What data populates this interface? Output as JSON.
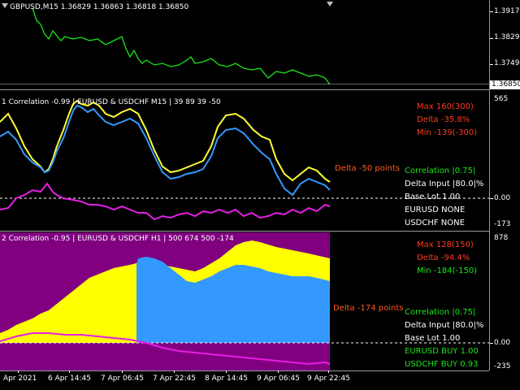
{
  "main": {
    "symbol_header": "GBPUSD,M15  1.36829 1.36863 1.36818 1.36850",
    "price_label": "1.36850",
    "scale": [
      "1.39170",
      "1.38290",
      "1.37490"
    ],
    "series_color": "#19e619",
    "price_path": [
      [
        40,
        10
      ],
      [
        45,
        25
      ],
      [
        50,
        30
      ],
      [
        55,
        42
      ],
      [
        60,
        48
      ],
      [
        65,
        38
      ],
      [
        70,
        44
      ],
      [
        75,
        50
      ],
      [
        80,
        45
      ],
      [
        90,
        48
      ],
      [
        100,
        46
      ],
      [
        110,
        50
      ],
      [
        120,
        48
      ],
      [
        130,
        55
      ],
      [
        140,
        50
      ],
      [
        150,
        45
      ],
      [
        155,
        60
      ],
      [
        160,
        70
      ],
      [
        165,
        62
      ],
      [
        170,
        72
      ],
      [
        175,
        78
      ],
      [
        180,
        74
      ],
      [
        190,
        80
      ],
      [
        200,
        78
      ],
      [
        210,
        82
      ],
      [
        220,
        80
      ],
      [
        230,
        74
      ],
      [
        235,
        70
      ],
      [
        240,
        78
      ],
      [
        250,
        76
      ],
      [
        260,
        72
      ],
      [
        270,
        80
      ],
      [
        280,
        82
      ],
      [
        290,
        78
      ],
      [
        300,
        84
      ],
      [
        310,
        86
      ],
      [
        320,
        84
      ],
      [
        330,
        96
      ],
      [
        335,
        92
      ],
      [
        340,
        88
      ],
      [
        350,
        90
      ],
      [
        360,
        86
      ],
      [
        370,
        90
      ],
      [
        380,
        94
      ],
      [
        390,
        92
      ],
      [
        400,
        96
      ],
      [
        406,
        104
      ]
    ]
  },
  "pane1": {
    "header": "1 Correlation -0.99 | EURUSD & USDCHF M15 |  39 89 39 -50",
    "scale": [
      "565",
      "0.00",
      "-173"
    ],
    "info": [
      {
        "text": "Max 160(300)",
        "color": "red"
      },
      {
        "text": "Delta -35.8%",
        "color": "red"
      },
      {
        "text": "Min -139(-300)",
        "color": "red"
      },
      {
        "text": "Correlation |0.75|",
        "color": "green"
      },
      {
        "text": "Delta Input |80.0|%",
        "color": "white"
      },
      {
        "text": "Base Lot 1.00",
        "color": "white"
      },
      {
        "text": "EURUSD NONE",
        "color": "white"
      },
      {
        "text": "USDCHF NONE",
        "color": "white"
      }
    ],
    "delta_label": "Delta -50 points",
    "series": [
      {
        "name": "EURUSD",
        "color": "#ffff33",
        "points": [
          [
            0,
            150
          ],
          [
            10,
            140
          ],
          [
            20,
            158
          ],
          [
            30,
            180
          ],
          [
            40,
            196
          ],
          [
            50,
            205
          ],
          [
            55,
            212
          ],
          [
            60,
            208
          ],
          [
            65,
            196
          ],
          [
            70,
            180
          ],
          [
            78,
            160
          ],
          [
            85,
            140
          ],
          [
            90,
            128
          ],
          [
            95,
            124
          ],
          [
            100,
            128
          ],
          [
            108,
            130
          ],
          [
            115,
            126
          ],
          [
            122,
            130
          ],
          [
            130,
            140
          ],
          [
            140,
            144
          ],
          [
            150,
            138
          ],
          [
            160,
            134
          ],
          [
            170,
            140
          ],
          [
            180,
            160
          ],
          [
            190,
            185
          ],
          [
            200,
            205
          ],
          [
            210,
            212
          ],
          [
            220,
            210
          ],
          [
            230,
            206
          ],
          [
            240,
            202
          ],
          [
            250,
            198
          ],
          [
            260,
            180
          ],
          [
            268,
            156
          ],
          [
            278,
            142
          ],
          [
            290,
            140
          ],
          [
            300,
            146
          ],
          [
            312,
            160
          ],
          [
            322,
            168
          ],
          [
            332,
            172
          ],
          [
            340,
            196
          ],
          [
            350,
            214
          ],
          [
            360,
            222
          ],
          [
            370,
            214
          ],
          [
            380,
            206
          ],
          [
            390,
            210
          ],
          [
            400,
            220
          ],
          [
            406,
            224
          ]
        ]
      },
      {
        "name": "USDCHF",
        "color": "#3399ff",
        "points": [
          [
            0,
            168
          ],
          [
            10,
            162
          ],
          [
            20,
            172
          ],
          [
            30,
            190
          ],
          [
            40,
            200
          ],
          [
            50,
            206
          ],
          [
            55,
            212
          ],
          [
            60,
            210
          ],
          [
            65,
            200
          ],
          [
            70,
            186
          ],
          [
            78,
            170
          ],
          [
            85,
            150
          ],
          [
            90,
            136
          ],
          [
            95,
            130
          ],
          [
            100,
            132
          ],
          [
            108,
            138
          ],
          [
            115,
            134
          ],
          [
            122,
            142
          ],
          [
            130,
            150
          ],
          [
            140,
            154
          ],
          [
            150,
            150
          ],
          [
            160,
            146
          ],
          [
            170,
            152
          ],
          [
            180,
            170
          ],
          [
            190,
            192
          ],
          [
            200,
            212
          ],
          [
            210,
            220
          ],
          [
            220,
            218
          ],
          [
            230,
            214
          ],
          [
            240,
            212
          ],
          [
            250,
            208
          ],
          [
            260,
            192
          ],
          [
            268,
            170
          ],
          [
            278,
            160
          ],
          [
            290,
            158
          ],
          [
            300,
            164
          ],
          [
            312,
            178
          ],
          [
            322,
            188
          ],
          [
            332,
            196
          ],
          [
            340,
            214
          ],
          [
            350,
            232
          ],
          [
            360,
            240
          ],
          [
            370,
            226
          ],
          [
            380,
            220
          ],
          [
            390,
            224
          ],
          [
            400,
            228
          ],
          [
            406,
            234
          ]
        ]
      },
      {
        "name": "Spread",
        "color": "#e61ee6",
        "points": [
          [
            0,
            258
          ],
          [
            10,
            256
          ],
          [
            20,
            244
          ],
          [
            30,
            240
          ],
          [
            40,
            234
          ],
          [
            50,
            236
          ],
          [
            58,
            226
          ],
          [
            65,
            236
          ],
          [
            70,
            240
          ],
          [
            78,
            244
          ],
          [
            90,
            246
          ],
          [
            100,
            248
          ],
          [
            110,
            252
          ],
          [
            120,
            252
          ],
          [
            130,
            254
          ],
          [
            140,
            258
          ],
          [
            150,
            254
          ],
          [
            160,
            258
          ],
          [
            170,
            262
          ],
          [
            180,
            262
          ],
          [
            190,
            270
          ],
          [
            200,
            266
          ],
          [
            210,
            268
          ],
          [
            220,
            264
          ],
          [
            230,
            262
          ],
          [
            240,
            266
          ],
          [
            250,
            260
          ],
          [
            260,
            262
          ],
          [
            270,
            258
          ],
          [
            280,
            262
          ],
          [
            290,
            258
          ],
          [
            300,
            266
          ],
          [
            310,
            262
          ],
          [
            320,
            268
          ],
          [
            330,
            266
          ],
          [
            340,
            262
          ],
          [
            350,
            264
          ],
          [
            360,
            258
          ],
          [
            370,
            262
          ],
          [
            380,
            256
          ],
          [
            390,
            260
          ],
          [
            400,
            252
          ],
          [
            406,
            254
          ]
        ]
      }
    ]
  },
  "pane2": {
    "header": "2 Correlation -0.95 | EURUSD & USDCHF H1 |  500 674 500 -174",
    "scale": [
      "878",
      "0.00",
      "-235"
    ],
    "info": [
      {
        "text": "Max 128(150)",
        "color": "red"
      },
      {
        "text": "Delta -94.4%",
        "color": "red"
      },
      {
        "text": "Min -184(-150)",
        "color": "green"
      },
      {
        "text": "Correlation |0.75|",
        "color": "green"
      },
      {
        "text": "Delta Input |80.0|%",
        "color": "white"
      },
      {
        "text": "Base Lot 1.00",
        "color": "white"
      },
      {
        "text": "EURUSD BUY 1.00",
        "color": "green"
      },
      {
        "text": "USDCHF BUY 0.93",
        "color": "green"
      }
    ],
    "delta_label": "Delta -174 points",
    "colors": {
      "background_fill": "#800080",
      "yellow": "#ffff00",
      "blue": "#3399ff",
      "magenta": "#e61ee6"
    },
    "yellow_top": [
      [
        0,
        410
      ],
      [
        10,
        406
      ],
      [
        20,
        400
      ],
      [
        30,
        396
      ],
      [
        40,
        392
      ],
      [
        50,
        386
      ],
      [
        60,
        382
      ],
      [
        70,
        374
      ],
      [
        80,
        366
      ],
      [
        90,
        358
      ],
      [
        100,
        350
      ],
      [
        110,
        342
      ],
      [
        120,
        338
      ],
      [
        130,
        334
      ],
      [
        140,
        330
      ],
      [
        150,
        328
      ],
      [
        160,
        326
      ],
      [
        168,
        324
      ],
      [
        170,
        322
      ],
      [
        180,
        322
      ],
      [
        200,
        326
      ],
      [
        220,
        330
      ],
      [
        240,
        334
      ],
      [
        250,
        330
      ],
      [
        260,
        324
      ],
      [
        270,
        318
      ],
      [
        280,
        310
      ],
      [
        290,
        302
      ],
      [
        300,
        298
      ],
      [
        310,
        296
      ],
      [
        320,
        298
      ],
      [
        340,
        304
      ],
      [
        360,
        308
      ],
      [
        380,
        312
      ],
      [
        406,
        318
      ]
    ],
    "blue_top": [
      [
        0,
        416
      ],
      [
        10,
        412
      ],
      [
        20,
        408
      ],
      [
        30,
        406
      ],
      [
        40,
        402
      ],
      [
        50,
        398
      ],
      [
        60,
        392
      ],
      [
        70,
        384
      ],
      [
        80,
        374
      ],
      [
        90,
        364
      ],
      [
        100,
        354
      ],
      [
        110,
        346
      ],
      [
        120,
        340
      ],
      [
        130,
        336
      ],
      [
        140,
        332
      ],
      [
        150,
        330
      ],
      [
        160,
        328
      ],
      [
        168,
        326
      ],
      [
        170,
        318
      ],
      [
        180,
        316
      ],
      [
        190,
        318
      ],
      [
        200,
        322
      ],
      [
        210,
        330
      ],
      [
        220,
        338
      ],
      [
        230,
        346
      ],
      [
        240,
        348
      ],
      [
        250,
        344
      ],
      [
        260,
        340
      ],
      [
        270,
        334
      ],
      [
        280,
        330
      ],
      [
        290,
        326
      ],
      [
        300,
        326
      ],
      [
        310,
        328
      ],
      [
        320,
        330
      ],
      [
        330,
        334
      ],
      [
        340,
        336
      ],
      [
        350,
        338
      ],
      [
        360,
        340
      ],
      [
        370,
        340
      ],
      [
        380,
        340
      ],
      [
        390,
        342
      ],
      [
        406,
        346
      ]
    ],
    "magenta_line": [
      [
        0,
        420
      ],
      [
        20,
        414
      ],
      [
        40,
        410
      ],
      [
        60,
        410
      ],
      [
        80,
        412
      ],
      [
        100,
        412
      ],
      [
        120,
        414
      ],
      [
        140,
        416
      ],
      [
        160,
        418
      ],
      [
        170,
        420
      ],
      [
        180,
        422
      ],
      [
        200,
        428
      ],
      [
        220,
        432
      ],
      [
        240,
        434
      ],
      [
        260,
        436
      ],
      [
        280,
        438
      ],
      [
        300,
        440
      ],
      [
        320,
        442
      ],
      [
        340,
        444
      ],
      [
        360,
        446
      ],
      [
        380,
        448
      ],
      [
        400,
        446
      ],
      [
        406,
        448
      ]
    ]
  },
  "xaxis": [
    "Apr 2021",
    "6 Apr 14:45",
    "7 Apr 06:45",
    "7 Apr 22:45",
    "8 Apr 14:45",
    "9 Apr 06:45",
    "9 Apr 22:45"
  ]
}
